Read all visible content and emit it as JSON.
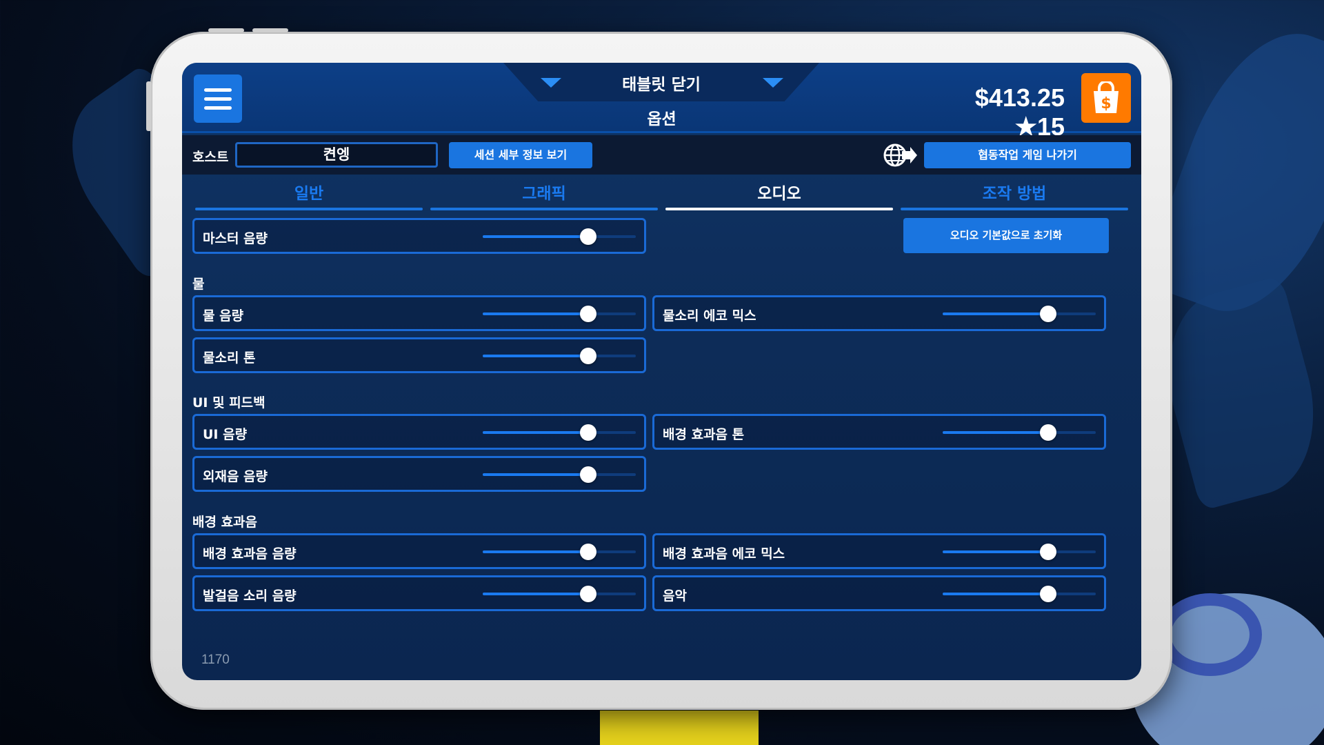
{
  "top_bar": {
    "close_tablet_label": "태블릿 닫기",
    "title": "옵션",
    "money": "$413.25",
    "stars": "★15",
    "menu_icon": "hamburger-menu-icon",
    "shop_icon": "shopping-bag-dollar-icon"
  },
  "host_bar": {
    "host_label": "호스트",
    "host_name": "켠엥",
    "session_details_button": "세션 세부 정보 보기",
    "globe_icon": "globe-exit-icon",
    "leave_coop_button": "협동작업 게임 나가기"
  },
  "tabs": [
    {
      "label": "일반",
      "active": false
    },
    {
      "label": "그래픽",
      "active": false
    },
    {
      "label": "오디오",
      "active": true
    },
    {
      "label": "조작 방법",
      "active": false
    }
  ],
  "audio": {
    "master": {
      "label": "마스터 음량",
      "value": 0.69
    },
    "reset_button": "오디오 기본값으로 초기화",
    "sections": [
      {
        "title": "물",
        "left": [
          {
            "label": "물 음량",
            "value": 0.69
          },
          {
            "label": "물소리 톤",
            "value": 0.69
          }
        ],
        "right": [
          {
            "label": "물소리 에코 믹스",
            "value": 0.69
          }
        ]
      },
      {
        "title": "UI 및 피드백",
        "left": [
          {
            "label": "UI 음량",
            "value": 0.69
          },
          {
            "label": "외재음 음량",
            "value": 0.69
          }
        ],
        "right": [
          {
            "label": "배경 효과음 톤",
            "value": 0.69
          }
        ]
      },
      {
        "title": "배경 효과음",
        "left": [
          {
            "label": "배경 효과음 음량",
            "value": 0.69
          },
          {
            "label": "발걸음 소리 음량",
            "value": 0.69
          }
        ],
        "right": [
          {
            "label": "배경 효과음 에코 믹스",
            "value": 0.69
          },
          {
            "label": "음악",
            "value": 0.69
          }
        ]
      }
    ]
  },
  "build_number": "1170",
  "colors": {
    "accent": "#1a75e0",
    "shop": "#ff7a00",
    "panel": "#0d2c58"
  }
}
